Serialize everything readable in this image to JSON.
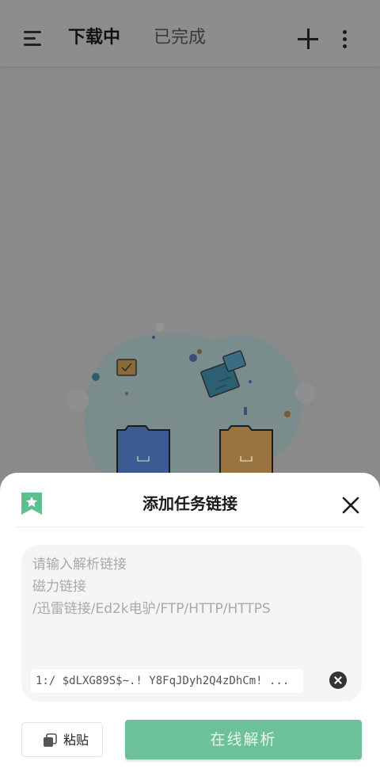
{
  "header": {
    "tabs": [
      {
        "label": "下载中",
        "active": true
      },
      {
        "label": "已完成",
        "active": false
      }
    ]
  },
  "sheet": {
    "title": "添加任务链接",
    "input": {
      "placeholder_lines": [
        "请输入解析链接",
        "磁力链接",
        "/迅雷链接/Ed2k电驴/FTP/HTTP/HTTPS"
      ],
      "clipboard_preview": "1:/ $dLXG89S$~.! Y8FqJDyh2Q4zDhCm! ..."
    },
    "paste_label": "粘贴",
    "parse_label": "在线解析"
  },
  "colors": {
    "accent_green": "#6dc199",
    "bookmark_green": "#5fc08f",
    "overlay_gray": "#8a8a8a",
    "folder_blue": "#3d5a93",
    "folder_orange": "#9a7440"
  }
}
